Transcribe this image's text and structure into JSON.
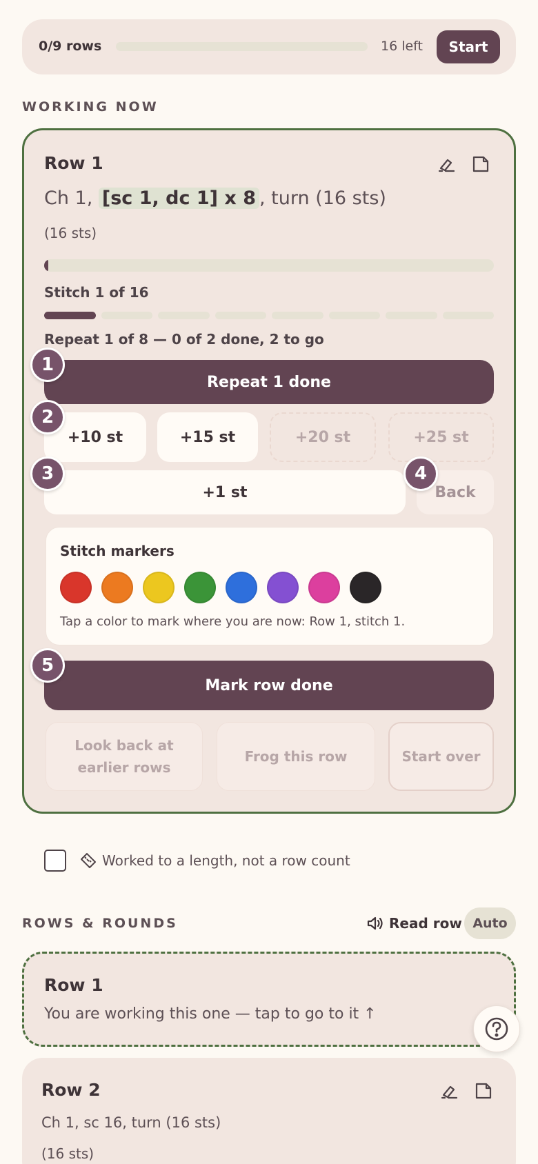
{
  "progress": {
    "count_label": "0/9 rows",
    "remaining_label": "16 left",
    "start_label": "Start",
    "fill_fraction": 0
  },
  "working_section_label": "WORKING NOW",
  "current_row": {
    "title": "Row 1",
    "instruction_prefix": "Ch 1, ",
    "instruction_highlight": "[sc 1, dc 1] x 8",
    "instruction_suffix": ", turn (16 sts)",
    "stitch_total": "(16 sts)",
    "stitch_progress_fraction": 0.0625,
    "stitch_label": "Stitch 1 of 16",
    "repeat_segments_total": 8,
    "repeat_segments_done": 1,
    "repeat_label": "Repeat 1 of 8 — 0 of 2 done, 2 to go",
    "repeat_done_label": "Repeat 1 done",
    "quick_adds": [
      {
        "label": "+10 st",
        "enabled": true
      },
      {
        "label": "+15 st",
        "enabled": true
      },
      {
        "label": "+20 st",
        "enabled": false
      },
      {
        "label": "+25 st",
        "enabled": false
      }
    ],
    "plus_one_label": "+1 st",
    "back_label": "Back",
    "badges": [
      "1",
      "2",
      "3",
      "4",
      "5"
    ],
    "markers": {
      "title": "Stitch markers",
      "colors": [
        "#d9362b",
        "#ec7a20",
        "#ecc71f",
        "#3b9438",
        "#2e6fdc",
        "#8450d2",
        "#dc3f9e",
        "#2a2628"
      ],
      "hint": "Tap a color to mark where you are now: Row 1, stitch 1."
    },
    "mark_row_done_label": "Mark row done",
    "secondary_actions": {
      "look_back": "Look back at earlier rows",
      "frog": "Frog this row",
      "start_over": "Start over"
    }
  },
  "length_option_label": "Worked to a length, not a row count",
  "rows_section_label": "ROWS & ROUNDS",
  "read_row_label": "Read row",
  "auto_label": "Auto",
  "rows": [
    {
      "title": "Row 1",
      "note": "You are working this one — tap to go to it ↑"
    },
    {
      "title": "Row 2",
      "instruction": "Ch 1, sc 16, turn (16 sts)",
      "stitch_total": "(16 sts)"
    }
  ],
  "colors": {
    "accent": "#624452",
    "badge": "#77536a",
    "working_border": "#4e7040",
    "card_bg": "#f2e6e0",
    "page_bg": "#fdf9f3"
  }
}
